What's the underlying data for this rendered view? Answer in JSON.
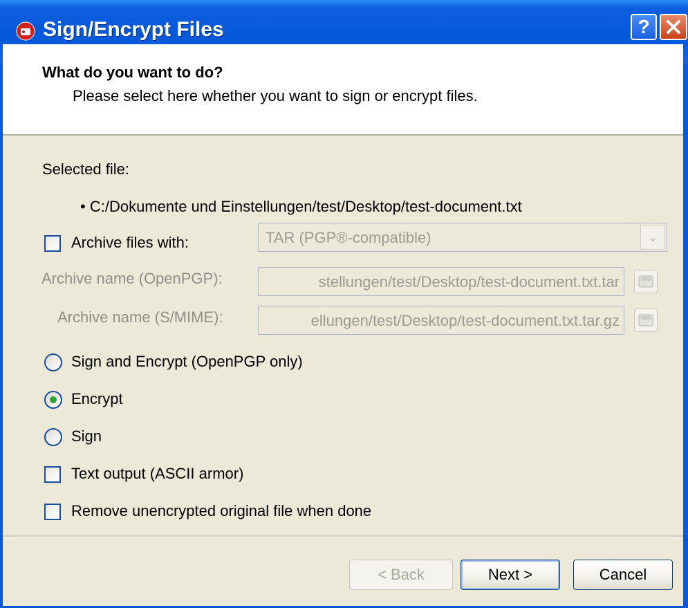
{
  "window": {
    "title": "Sign/Encrypt Files"
  },
  "header": {
    "title": "What do you want to do?",
    "subtitle": "Please select here whether you want to sign or encrypt files."
  },
  "selection": {
    "label": "Selected file:",
    "files": [
      "C:/Dokumente und Einstellungen/test/Desktop/test-document.txt"
    ]
  },
  "archive": {
    "checkbox_label": "Archive files with:",
    "checked": false,
    "format_selected": "TAR (PGP®-compatible)",
    "openpgp_label": "Archive name (OpenPGP):",
    "openpgp_value": "stellungen/test/Desktop/test-document.txt.tar",
    "smime_label": "Archive name (S/MIME):",
    "smime_value": "ellungen/test/Desktop/test-document.txt.tar.gz"
  },
  "operations": [
    {
      "label": "Sign and Encrypt (OpenPGP only)",
      "selected": false
    },
    {
      "label": "Encrypt",
      "selected": true
    },
    {
      "label": "Sign",
      "selected": false
    }
  ],
  "options": {
    "ascii_armor_label": "Text output (ASCII armor)",
    "ascii_armor_checked": false,
    "remove_original_label": "Remove unencrypted original file when done",
    "remove_original_checked": false
  },
  "buttons": {
    "back": "< Back",
    "next": "Next >",
    "cancel": "Cancel"
  },
  "colors": {
    "titlebar": "#0558d8",
    "dialog_bg": "#ece9d8",
    "radio_selected": "#2fa332"
  }
}
